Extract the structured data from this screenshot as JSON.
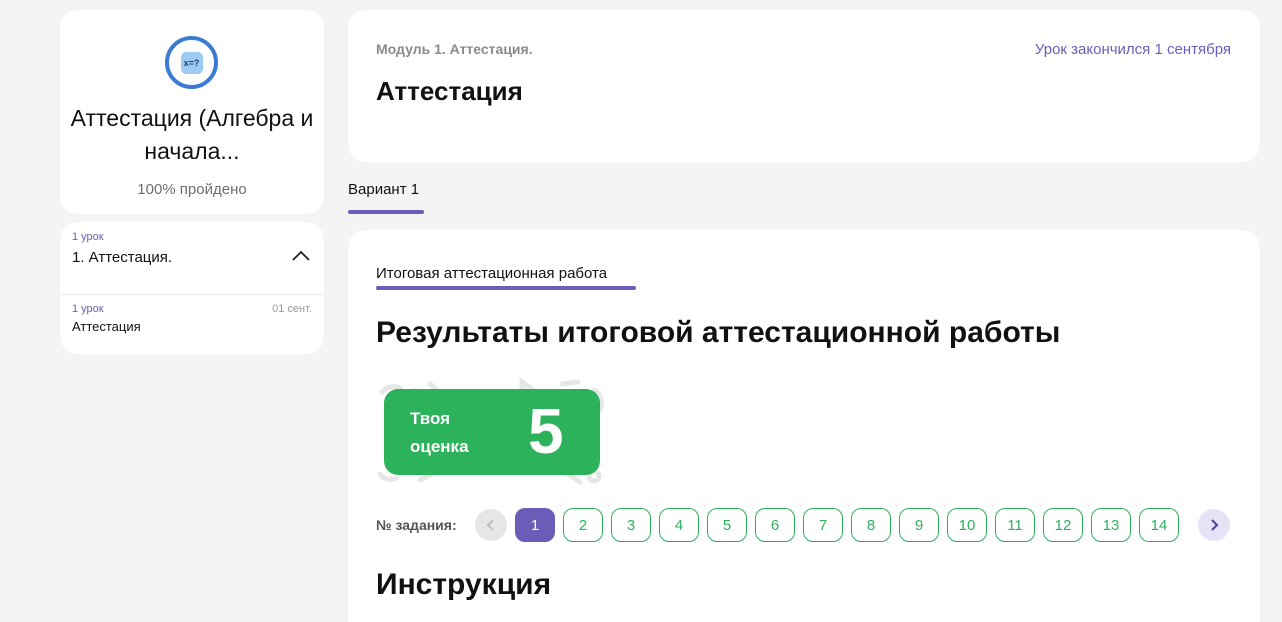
{
  "course": {
    "icon_text": "x=?",
    "title": "Аттестация (Алгебра и начала...",
    "progress": "100% пройдено"
  },
  "module": {
    "meta": "1 урок",
    "title": "1. Аттестация.",
    "lessons": [
      {
        "meta": "1 урок",
        "title": "Аттестация",
        "date": "01 сент."
      }
    ]
  },
  "header": {
    "module_label": "Модуль 1. Аттестация.",
    "status": "Урок закончился 1 сентября",
    "title": "Аттестация"
  },
  "variant_tab": "Вариант 1",
  "work_tab": "Итоговая аттестационная работа",
  "results_title": "Результаты итоговой аттестационной работы",
  "grade": {
    "label": "Твоя оценка",
    "value": "5"
  },
  "task_nav": {
    "label": "№ задания:",
    "tasks": [
      "1",
      "2",
      "3",
      "4",
      "5",
      "6",
      "7",
      "8",
      "9",
      "10",
      "11",
      "12",
      "13",
      "14"
    ],
    "active": "1"
  },
  "instruction_title": "Инструкция",
  "colors": {
    "accent": "#6a5db8",
    "success": "#2db25c",
    "icon_blue": "#3a7bd5",
    "background": "#f4f4f4"
  }
}
